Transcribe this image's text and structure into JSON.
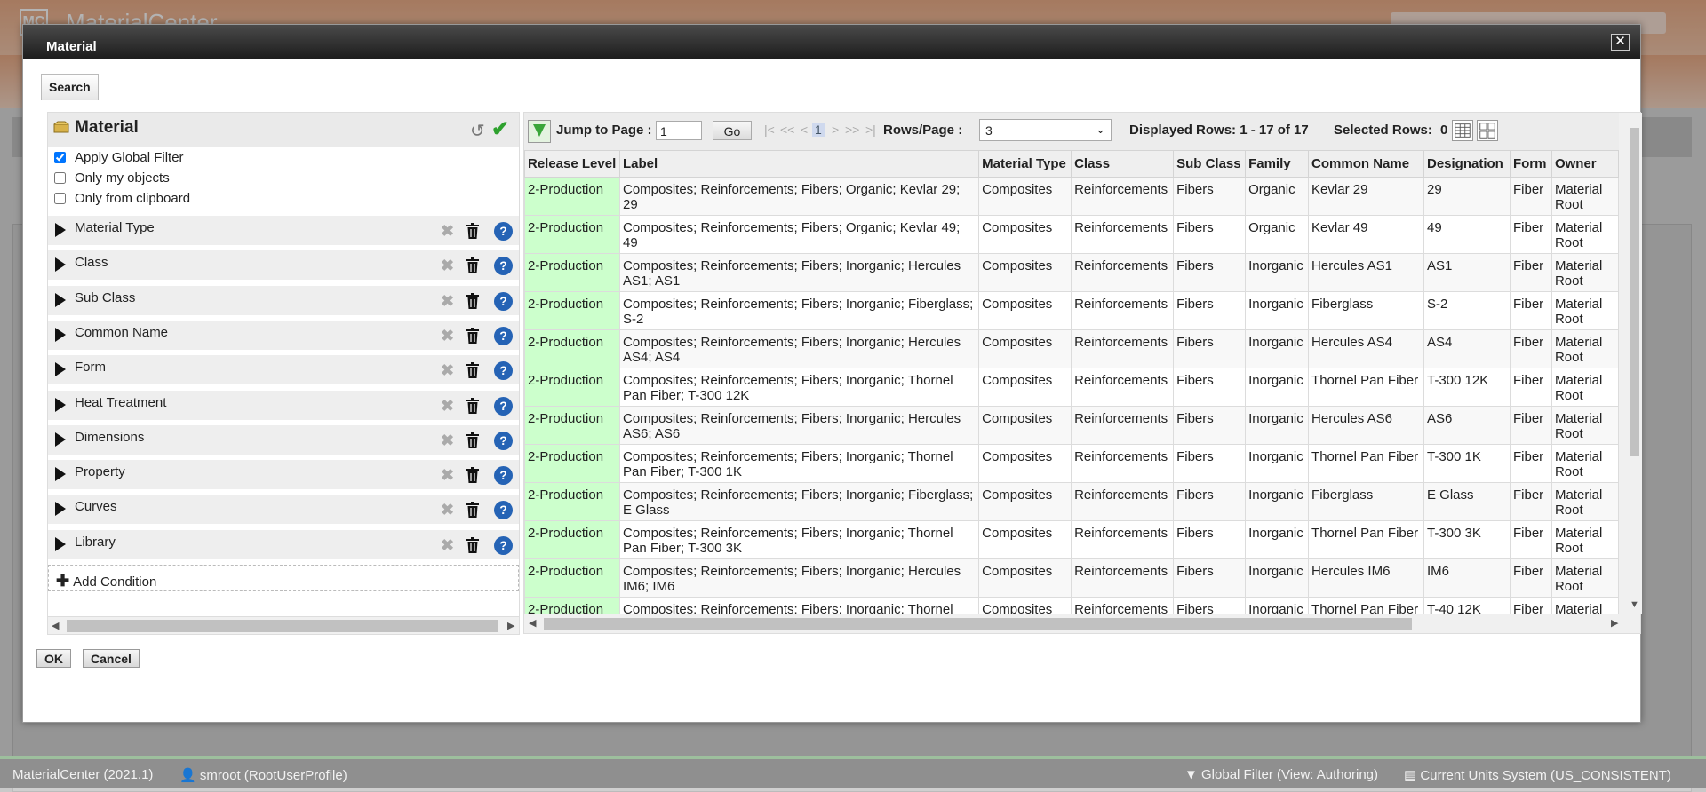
{
  "app": {
    "logo": "MC",
    "name": "MaterialCenter"
  },
  "statusbar": {
    "version": "MaterialCenter (2021.1)",
    "user": "smroot (RootUserProfile)",
    "global_filter": "Global Filter (View: Authoring)",
    "units": "Current Units System (US_CONSISTENT)"
  },
  "dialog": {
    "title": "Material",
    "close_icon": "close-icon",
    "tab_label": "Search",
    "ok_label": "OK",
    "cancel_label": "Cancel"
  },
  "search_panel": {
    "title": "Material",
    "checkboxes": [
      {
        "label": "Apply Global Filter",
        "checked": true
      },
      {
        "label": "Only my objects",
        "checked": false
      },
      {
        "label": "Only from clipboard",
        "checked": false
      }
    ],
    "conditions": [
      {
        "label": "Material Type"
      },
      {
        "label": "Class"
      },
      {
        "label": "Sub Class"
      },
      {
        "label": "Common Name"
      },
      {
        "label": "Form"
      },
      {
        "label": "Heat Treatment"
      },
      {
        "label": "Dimensions"
      },
      {
        "label": "Property"
      },
      {
        "label": "Curves"
      },
      {
        "label": "Library"
      }
    ],
    "add_condition_label": "Add Condition"
  },
  "grid": {
    "jump_label": "Jump to Page :",
    "page_value": "1",
    "go_label": "Go",
    "pager": {
      "first": "|<",
      "prev_block": "<<",
      "prev": "<",
      "current": "1",
      "next": ">",
      "next_block": ">>",
      "last": ">|"
    },
    "rows_per_page_label": "Rows/Page :",
    "rows_per_page_value": "3",
    "displayed_rows": "Displayed Rows: 1 - 17 of 17",
    "selected_rows_label": "Selected Rows:",
    "selected_rows_value": "0",
    "columns": [
      "Release Level",
      "Label",
      "Material Type",
      "Class",
      "Sub Class",
      "Family",
      "Common Name",
      "Designation",
      "Form",
      "Owner"
    ],
    "rows": [
      [
        "2-Production",
        "Composites; Reinforcements; Fibers; Organic; Kevlar 29; 29",
        "Composites",
        "Reinforcements",
        "Fibers",
        "Organic",
        "Kevlar 29",
        "29",
        "Fiber",
        "Material Root"
      ],
      [
        "2-Production",
        "Composites; Reinforcements; Fibers; Organic; Kevlar 49; 49",
        "Composites",
        "Reinforcements",
        "Fibers",
        "Organic",
        "Kevlar 49",
        "49",
        "Fiber",
        "Material Root"
      ],
      [
        "2-Production",
        "Composites; Reinforcements; Fibers; Inorganic; Hercules AS1; AS1",
        "Composites",
        "Reinforcements",
        "Fibers",
        "Inorganic",
        "Hercules AS1",
        "AS1",
        "Fiber",
        "Material Root"
      ],
      [
        "2-Production",
        "Composites; Reinforcements; Fibers; Inorganic; Fiberglass; S-2",
        "Composites",
        "Reinforcements",
        "Fibers",
        "Inorganic",
        "Fiberglass",
        "S-2",
        "Fiber",
        "Material Root"
      ],
      [
        "2-Production",
        "Composites; Reinforcements; Fibers; Inorganic; Hercules AS4; AS4",
        "Composites",
        "Reinforcements",
        "Fibers",
        "Inorganic",
        "Hercules AS4",
        "AS4",
        "Fiber",
        "Material Root"
      ],
      [
        "2-Production",
        "Composites; Reinforcements; Fibers; Inorganic; Thornel Pan Fiber; T-300 12K",
        "Composites",
        "Reinforcements",
        "Fibers",
        "Inorganic",
        "Thornel Pan Fiber",
        "T-300 12K",
        "Fiber",
        "Material Root"
      ],
      [
        "2-Production",
        "Composites; Reinforcements; Fibers; Inorganic; Hercules AS6; AS6",
        "Composites",
        "Reinforcements",
        "Fibers",
        "Inorganic",
        "Hercules AS6",
        "AS6",
        "Fiber",
        "Material Root"
      ],
      [
        "2-Production",
        "Composites; Reinforcements; Fibers; Inorganic; Thornel Pan Fiber; T-300 1K",
        "Composites",
        "Reinforcements",
        "Fibers",
        "Inorganic",
        "Thornel Pan Fiber",
        "T-300 1K",
        "Fiber",
        "Material Root"
      ],
      [
        "2-Production",
        "Composites; Reinforcements; Fibers; Inorganic; Fiberglass; E Glass",
        "Composites",
        "Reinforcements",
        "Fibers",
        "Inorganic",
        "Fiberglass",
        "E Glass",
        "Fiber",
        "Material Root"
      ],
      [
        "2-Production",
        "Composites; Reinforcements; Fibers; Inorganic; Thornel Pan Fiber; T-300 3K",
        "Composites",
        "Reinforcements",
        "Fibers",
        "Inorganic",
        "Thornel Pan Fiber",
        "T-300 3K",
        "Fiber",
        "Material Root"
      ],
      [
        "2-Production",
        "Composites; Reinforcements; Fibers; Inorganic; Hercules IM6; IM6",
        "Composites",
        "Reinforcements",
        "Fibers",
        "Inorganic",
        "Hercules IM6",
        "IM6",
        "Fiber",
        "Material Root"
      ],
      [
        "2-Production",
        "Composites; Reinforcements; Fibers; Inorganic; Thornel",
        "Composites",
        "Reinforcements",
        "Fibers",
        "Inorganic",
        "Thornel Pan Fiber",
        "T-40 12K",
        "Fiber",
        "Material"
      ]
    ]
  },
  "colors": {
    "release_level_bg": "#ccffcc",
    "title_bar": "#2a2a2a",
    "help_icon": "#2563b5",
    "apply_check": "#2ea12e"
  }
}
